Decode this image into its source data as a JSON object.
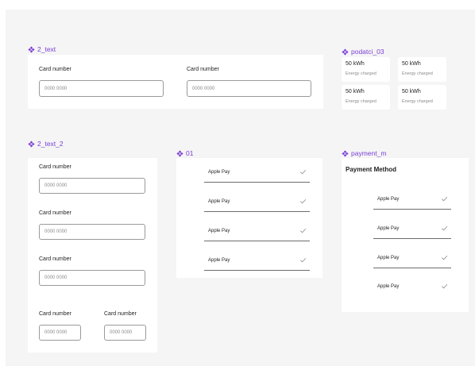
{
  "colors": {
    "canvas": "#f5f5f5",
    "component_label": "#7b3fd6",
    "frame": "#ffffff",
    "field_border": "#9a9a9a",
    "placeholder": "#8a8a8a"
  },
  "icons": {
    "component": "component-diamond-icon",
    "check": "check-icon"
  },
  "components": {
    "text_2": {
      "label": "2_text",
      "fields": [
        {
          "label": "Card number",
          "value": "0000 0000"
        },
        {
          "label": "Card number",
          "value": "0000 0000"
        }
      ]
    },
    "podatci": {
      "label": "podatci_03",
      "stats": [
        {
          "value": "50 kWh",
          "caption": "Energy charged"
        },
        {
          "value": "50 kWh",
          "caption": "Energy charged"
        },
        {
          "value": "50 kWh",
          "caption": "Energy charged"
        },
        {
          "value": "50 kWh",
          "caption": "Energy charged"
        }
      ]
    },
    "text_2_2": {
      "label": "2_text_2",
      "fields": [
        {
          "label": "Card number",
          "value": "0000 0000"
        },
        {
          "label": "Card number",
          "value": "0000 0000"
        },
        {
          "label": "Card number",
          "value": "0000 0000"
        }
      ],
      "split_fields": [
        {
          "label": "Card number",
          "value": "0000 0000"
        },
        {
          "label": "Card number",
          "value": "0000 0000"
        }
      ]
    },
    "list_01": {
      "label": "01",
      "options": [
        "Apple Pay",
        "Apple Pay",
        "Apple Pay",
        "Apple Pay"
      ]
    },
    "payment": {
      "label": "payment_m",
      "title": "Payment Method",
      "options": [
        "Apple Pay",
        "Apple Pay",
        "Apple Pay",
        "Apple Pay"
      ]
    }
  }
}
